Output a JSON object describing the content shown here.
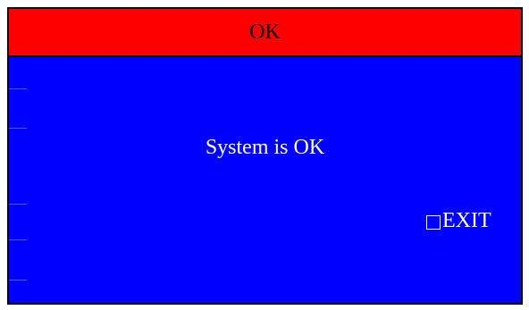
{
  "colors": {
    "title_background": "#ff0000",
    "body_background": "#0000ff",
    "title_text": "#000000",
    "body_text": "#ffffff"
  },
  "dialog": {
    "title": "OK",
    "message": "System is OK",
    "exit_label": "EXIT",
    "exit_icon": "checkbox-icon"
  }
}
